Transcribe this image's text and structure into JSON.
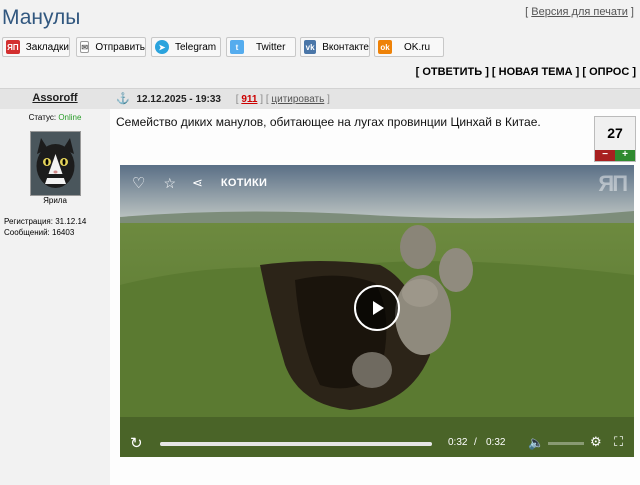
{
  "page": {
    "title": "Манулы",
    "print_link": "Версия для печати"
  },
  "share": [
    {
      "label": "Закладки",
      "icon": "yap-icon",
      "color": "#d32f2f",
      "glyph": "ЯП"
    },
    {
      "label": "Отправить",
      "icon": "mail-icon",
      "color": "#888888",
      "glyph": "✉"
    },
    {
      "label": "Telegram",
      "icon": "telegram-icon",
      "color": "#2aa3dd",
      "glyph": "➤"
    },
    {
      "label": "Twitter",
      "icon": "twitter-icon",
      "color": "#55acee",
      "glyph": "t"
    },
    {
      "label": "Вконтакте",
      "icon": "vk-icon",
      "color": "#4a76a8",
      "glyph": "vk"
    },
    {
      "label": "OK.ru",
      "icon": "ok-icon",
      "color": "#ee8208",
      "glyph": "ok"
    }
  ],
  "actions": {
    "reply": "ОТВЕТИТЬ",
    "new_topic": "НОВАЯ ТЕМА",
    "poll": "ОПРОС"
  },
  "post": {
    "author": "Assoroff",
    "date": "12.12.2025 - 19:33",
    "number": "911",
    "cite": "цитировать",
    "status_label": "Статус:",
    "status_value": "Online",
    "avatar_caption": "Ярила",
    "reg_label": "Регистрация:",
    "reg_value": "31.12.14",
    "msgs_label": "Сообщений:",
    "msgs_value": "16403",
    "text": "Семейство диких манулов, обитающее на лугах провинции Цинхай в Китае.",
    "rating": "27",
    "rating_minus": "−",
    "rating_plus": "+"
  },
  "video": {
    "tag": "КОТИКИ",
    "current_time": "0:32",
    "separator": "/",
    "duration": "0:32",
    "watermark": "ЯП",
    "progress": 1.0
  }
}
